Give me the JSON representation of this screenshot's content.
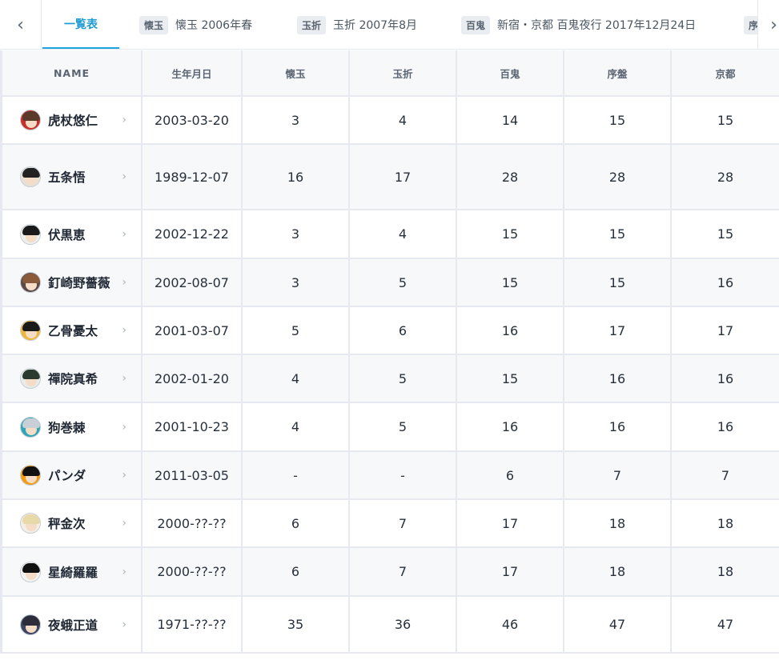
{
  "tabs": {
    "prev_glyph": "‹",
    "next_glyph": "›",
    "items": [
      {
        "label": "一覧表"
      },
      {
        "badge": "懐玉",
        "label": "懐玉 2006年春"
      },
      {
        "badge": "玉折",
        "label": "玉折 2007年8月"
      },
      {
        "badge": "百鬼",
        "label": "新宿・京都 百鬼夜行 2017年12月24日"
      },
      {
        "badge": "序"
      }
    ]
  },
  "table": {
    "headers": [
      "NAME",
      "生年月日",
      "懐玉",
      "玉折",
      "百鬼",
      "序盤",
      "京都"
    ],
    "chevron": "›",
    "rows": [
      {
        "name": "虎杖悠仁",
        "birth": "2003-03-20",
        "kaigyoku": "3",
        "gyokusetsu": "4",
        "hyakki": "14",
        "joban": "15",
        "kyoto": "15",
        "hair": "#5a3a2a",
        "bg": "#c9302c"
      },
      {
        "name": "五条悟",
        "birth": "1989-12-07",
        "kaigyoku": "16",
        "gyokusetsu": "17",
        "hyakki": "28",
        "joban": "28",
        "kyoto": "28",
        "hair": "#222222",
        "bg": "#e8e1d6"
      },
      {
        "name": "伏黒恵",
        "birth": "2002-12-22",
        "kaigyoku": "3",
        "gyokusetsu": "4",
        "hyakki": "15",
        "joban": "15",
        "kyoto": "15",
        "hair": "#1a1a1a",
        "bg": "#eeeeee"
      },
      {
        "name": "釘崎野薔薇",
        "birth": "2002-08-07",
        "kaigyoku": "3",
        "gyokusetsu": "5",
        "hyakki": "15",
        "joban": "15",
        "kyoto": "16",
        "hair": "#8a5a3a",
        "bg": "#5b4a45"
      },
      {
        "name": "乙骨憂太",
        "birth": "2001-03-07",
        "kaigyoku": "5",
        "gyokusetsu": "6",
        "hyakki": "16",
        "joban": "17",
        "kyoto": "17",
        "hair": "#1a1a1a",
        "bg": "#f0b63a"
      },
      {
        "name": "禪院真希",
        "birth": "2002-01-20",
        "kaigyoku": "4",
        "gyokusetsu": "5",
        "hyakki": "15",
        "joban": "16",
        "kyoto": "16",
        "hair": "#2b3a2f",
        "bg": "#e7ecea"
      },
      {
        "name": "狗巻棘",
        "birth": "2001-10-23",
        "kaigyoku": "4",
        "gyokusetsu": "5",
        "hyakki": "16",
        "joban": "16",
        "kyoto": "16",
        "hair": "#c9cfd6",
        "bg": "#2fa5b8"
      },
      {
        "name": "パンダ",
        "birth": "2011-03-05",
        "kaigyoku": "-",
        "gyokusetsu": "-",
        "hyakki": "6",
        "joban": "7",
        "kyoto": "7",
        "hair": "#111111",
        "bg": "#f39c12"
      },
      {
        "name": "秤金次",
        "birth": "2000-??-??",
        "kaigyoku": "6",
        "gyokusetsu": "7",
        "hyakki": "17",
        "joban": "18",
        "kyoto": "18",
        "hair": "#e8d9a8",
        "bg": "#f4efe6"
      },
      {
        "name": "星綺羅羅",
        "birth": "2000-??-??",
        "kaigyoku": "6",
        "gyokusetsu": "7",
        "hyakki": "17",
        "joban": "18",
        "kyoto": "18",
        "hair": "#111111",
        "bg": "#f4f4f4"
      },
      {
        "name": "夜蛾正道",
        "birth": "1971-??-??",
        "kaigyoku": "35",
        "gyokusetsu": "36",
        "hyakki": "46",
        "joban": "47",
        "kyoto": "47",
        "hair": "#2c2c3a",
        "bg": "#3d4660"
      }
    ]
  },
  "colors": {
    "accent": "#1fa6e0",
    "border": "#e6e9ef",
    "alt_row": "#f6f8fa"
  }
}
